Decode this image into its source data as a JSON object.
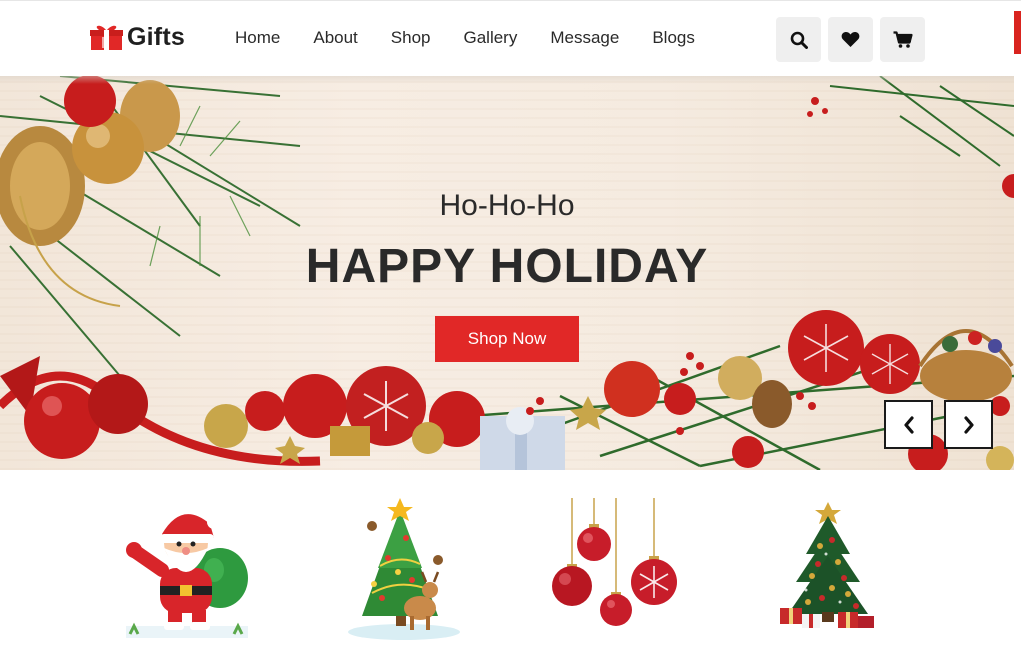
{
  "brand": {
    "name": "Gifts",
    "logo_icon": "gift-icon"
  },
  "nav": {
    "items": [
      {
        "label": "Home"
      },
      {
        "label": "About"
      },
      {
        "label": "Shop"
      },
      {
        "label": "Gallery"
      },
      {
        "label": "Message"
      },
      {
        "label": "Blogs"
      }
    ]
  },
  "header_icons": [
    "search-icon",
    "heart-icon",
    "cart-icon"
  ],
  "hero": {
    "subtitle": "Ho-Ho-Ho",
    "title": "HAPPY HOLIDAY",
    "cta_label": "Shop Now",
    "prev_icon": "chevron-left-icon",
    "next_icon": "chevron-right-icon"
  },
  "products": [
    {
      "image": "santa-claus-image"
    },
    {
      "image": "christmas-tree-reindeer-image"
    },
    {
      "image": "christmas-ornaments-image"
    },
    {
      "image": "decorated-christmas-tree-image"
    }
  ],
  "colors": {
    "accent": "#e12827",
    "text": "#2a2a2a",
    "icon_bg": "#efefef",
    "hero_bg": "#f5ebe0"
  }
}
